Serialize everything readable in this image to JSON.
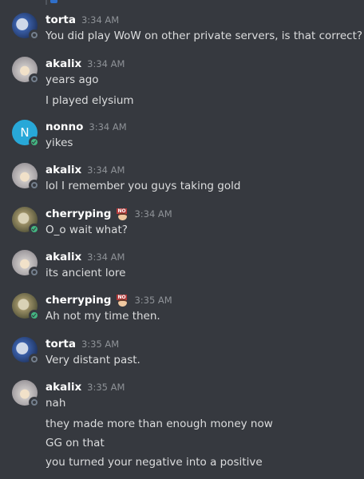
{
  "messages": [
    {
      "username": "torta",
      "avatar": "torta-avatar-wizard",
      "status": "idle",
      "time": "3:34 AM",
      "lines": [
        "You did play WoW on other private servers, is that correct?"
      ]
    },
    {
      "username": "akalix",
      "avatar": "akalix-avatar-anime",
      "status": "idle",
      "time": "3:34 AM",
      "lines": [
        "years ago",
        "I played elysium"
      ]
    },
    {
      "username": "nonno",
      "avatar_letter": "N",
      "status": "online",
      "time": "3:34 AM",
      "lines": [
        "yikes"
      ]
    },
    {
      "username": "akalix",
      "avatar": "akalix-avatar-anime",
      "status": "idle",
      "time": "3:34 AM",
      "lines": [
        "lol I remember you guys taking gold"
      ]
    },
    {
      "username": "cherryping",
      "avatar": "cherryping-avatar",
      "status": "online",
      "badge": "no-emoji-badge",
      "time": "3:34 AM",
      "lines": [
        "O_o wait what?"
      ]
    },
    {
      "username": "akalix",
      "avatar": "akalix-avatar-anime",
      "status": "idle",
      "time": "3:34 AM",
      "lines": [
        "its ancient lore"
      ]
    },
    {
      "username": "cherryping",
      "avatar": "cherryping-avatar",
      "status": "online",
      "badge": "no-emoji-badge",
      "time": "3:35 AM",
      "lines": [
        "Ah not my time then."
      ]
    },
    {
      "username": "torta",
      "avatar": "torta-avatar-wizard",
      "status": "idle",
      "time": "3:35 AM",
      "lines": [
        "Very distant past."
      ]
    },
    {
      "username": "akalix",
      "avatar": "akalix-avatar-anime",
      "status": "idle",
      "time": "3:35 AM",
      "lines": [
        "nah",
        "they made more than enough money now",
        "GG on that",
        "you turned your negative into a positive"
      ]
    }
  ],
  "theme": {
    "background": "#36393f",
    "username_color": "#ffffff",
    "timestamp_color": "#8e9297",
    "text_color": "#dcddde",
    "online_color": "#43b581",
    "idle_color": "#747f8d",
    "nonno_avatar_color": "#28a8d8"
  }
}
